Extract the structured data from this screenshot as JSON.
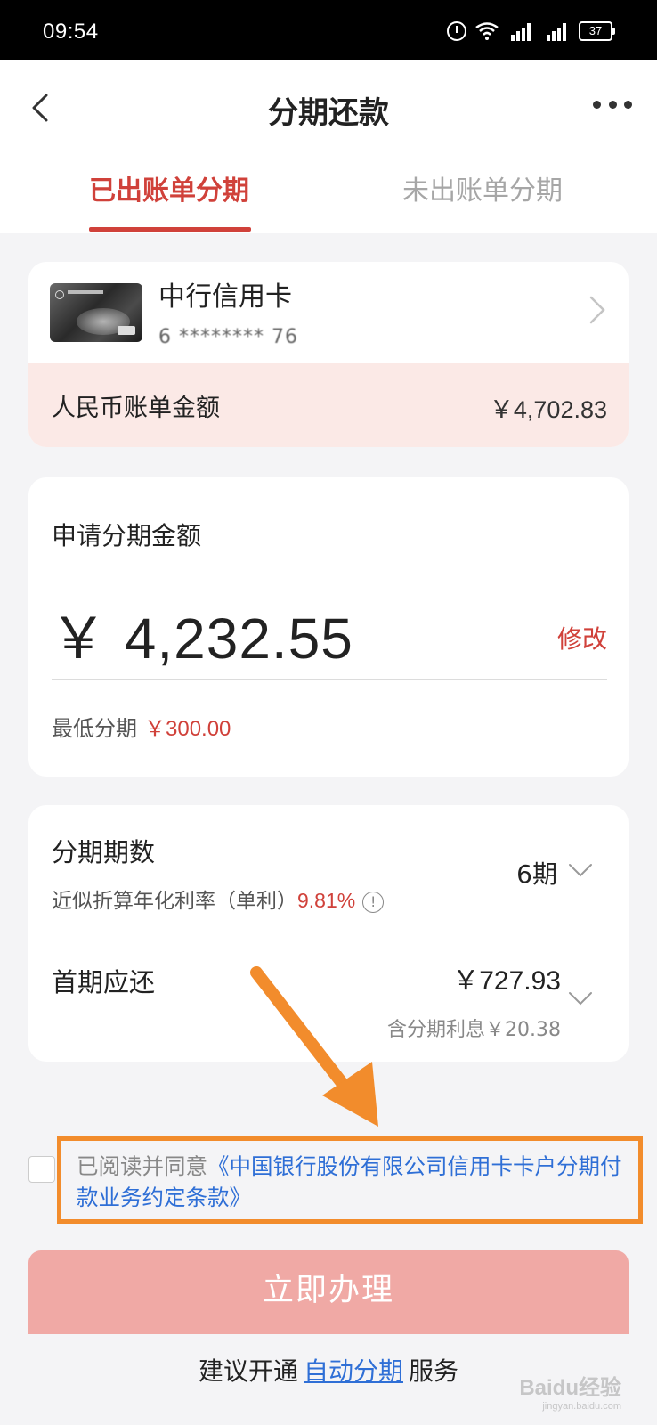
{
  "status_bar": {
    "time": "09:54",
    "battery": "37"
  },
  "header": {
    "title": "分期还款",
    "tabs": [
      {
        "label": "已出账单分期",
        "active": true
      },
      {
        "label": "未出账单分期",
        "active": false
      }
    ]
  },
  "card": {
    "name": "中行信用卡",
    "number_masked": "6  ********  76",
    "bill_label": "人民币账单金额",
    "bill_amount": "￥4,702.83"
  },
  "installment_amount": {
    "label": "申请分期金额",
    "value": "￥ 4,232.55",
    "modify_label": "修改",
    "min_label": "最低分期",
    "min_value": "￥300.00"
  },
  "terms": {
    "period_label": "分期期数",
    "rate_label": "近似折算年化利率（单利）",
    "rate_value": "9.81%",
    "period_value": "6期",
    "first_label": "首期应还",
    "first_value": "￥727.93",
    "first_interest": "含分期利息￥20.38"
  },
  "agreement": {
    "prefix": "已阅读并同意",
    "link_text": "《中国银行股份有限公司信用卡卡户分期付款业务约定条款》"
  },
  "submit": {
    "label": "立即办理"
  },
  "suggestion": {
    "prefix": "建议开通",
    "link": "自动分期",
    "suffix": "服务"
  },
  "watermark": {
    "text": "Baidu经验",
    "sub": "jingyan.baidu.com"
  },
  "colors": {
    "accent": "#d0413a",
    "link": "#2f6fd6",
    "highlight": "#f28c2c",
    "button_disabled": "#f0a9a5",
    "bill_row_bg": "#fbe9e6"
  }
}
